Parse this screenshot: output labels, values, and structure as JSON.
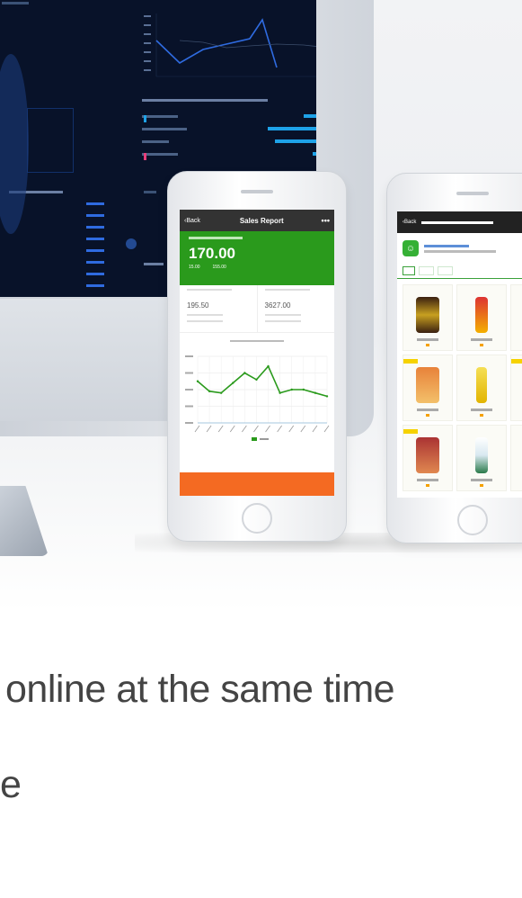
{
  "sales_report": {
    "back": "‹Back",
    "title": "Sales Report",
    "more": "•••",
    "amount": "170.00",
    "cost_value": "15.00",
    "profit_value": "155.00",
    "left_value": "195.50",
    "right_value": "3627.00",
    "legend_color": "#2a9a1c",
    "accent_orange": "#f46a22",
    "chart_data": {
      "type": "line",
      "x": [
        1,
        2,
        3,
        4,
        5,
        6,
        7,
        8,
        9,
        10,
        11,
        12
      ],
      "values": [
        250,
        190,
        180,
        240,
        300,
        260,
        340,
        180,
        200,
        200,
        180,
        160
      ],
      "ylim": [
        0,
        400
      ]
    }
  },
  "catalog": {
    "back": "‹Back",
    "shop_icon": "chat-icon",
    "brand_color": "#35b035"
  },
  "caption": {
    "line1": "online at the same time",
    "line2": "e"
  }
}
